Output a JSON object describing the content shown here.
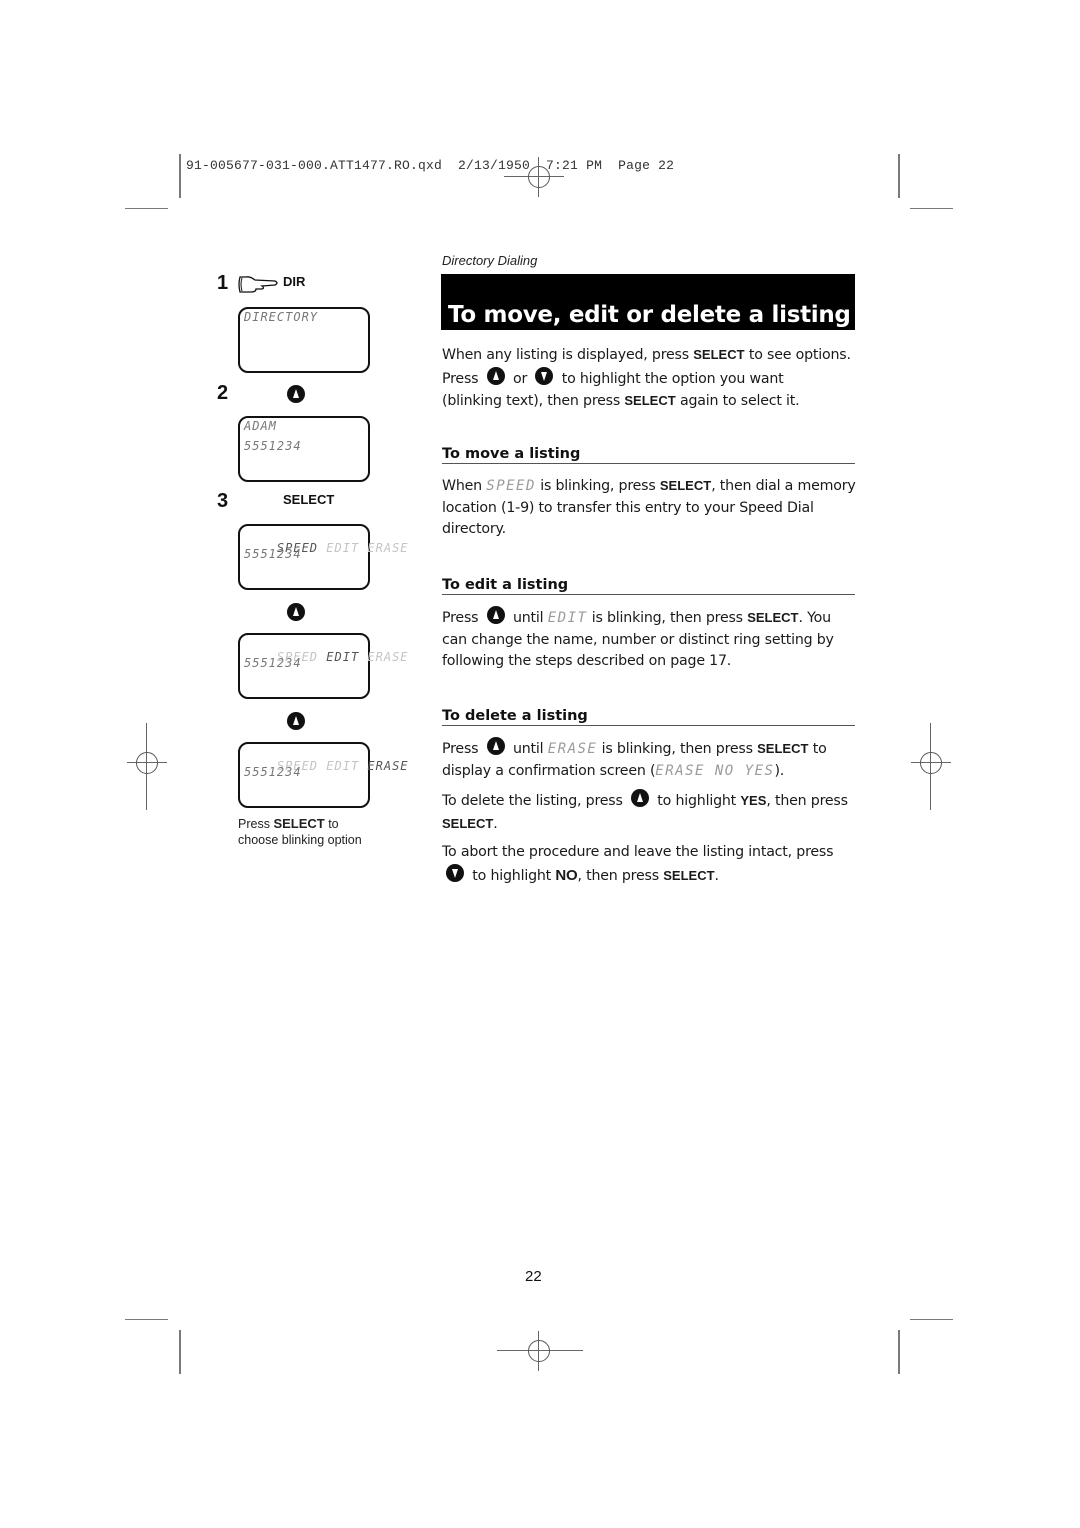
{
  "slug_line": "91-005677-031-000.ATT1477.RO.qxd  2/13/1950  7:21 PM  Page 22",
  "left_column": {
    "steps": [
      {
        "number": "1",
        "key": "DIR",
        "key_icon": "pointing-hand-icon"
      },
      {
        "number": "2",
        "key_icon": "up-arrow-button-icon"
      },
      {
        "number": "3",
        "key": "SELECT"
      }
    ],
    "screens": [
      {
        "line1": "DIRECTORY",
        "line2": ""
      },
      {
        "line1": "ADAM",
        "line2": "5551234"
      },
      {
        "options": [
          "SPEED",
          "EDIT",
          "ERASE"
        ],
        "active": "SPEED",
        "line2": "5551234"
      },
      {
        "options": [
          "SPEED",
          "EDIT",
          "ERASE"
        ],
        "active": "EDIT",
        "line2": "5551234"
      },
      {
        "options": [
          "SPEED",
          "EDIT",
          "ERASE"
        ],
        "active": "ERASE",
        "line2": "5551234"
      }
    ],
    "between_icons": [
      "up-arrow-button-icon",
      "up-arrow-button-icon"
    ],
    "caption": {
      "pre": "Press ",
      "key": "SELECT",
      "post": " to",
      "line2": "choose blinking option"
    }
  },
  "right_column": {
    "section_tag": "Directory Dialing",
    "title": "To move, edit or delete a listing",
    "intro": {
      "p1a": "When any listing is displayed, press ",
      "p1key": "SELECT",
      "p1b": " to see options.",
      "p2a": "Press ",
      "p2mid": " or ",
      "p2b": " to highlight the option you want",
      "p3a": "(blinking text), then press ",
      "p3key": "SELECT",
      "p3b": " again to select it."
    },
    "move": {
      "heading": "To move a listing",
      "a": "When ",
      "lcd": "SPEED",
      "b": " is blinking, press ",
      "key": "SELECT",
      "c": ", then dial a memory location (1-9) to transfer this entry to your Speed Dial directory."
    },
    "edit": {
      "heading": "To edit a listing",
      "a": "Press ",
      "b": " until ",
      "lcd": "EDIT",
      "c": " is blinking, then press ",
      "key": "SELECT",
      "d": ". You can change the name, number or distinct ring setting by following the steps described on page 17."
    },
    "delete": {
      "heading": "To delete a listing",
      "p1a": "Press ",
      "p1b": " until ",
      "p1lcd": "ERASE",
      "p1c": " is blinking, then press ",
      "p1key": "SELECT",
      "p1d": " to display a confirmation screen (",
      "p1lcd2": "ERASE NO YES",
      "p1e": ").",
      "p2a": "To delete the listing, press ",
      "p2b": " to highlight ",
      "p2key": "YES",
      "p2c": ", then press ",
      "p2key2": "SELECT",
      "p2d": ".",
      "p3a": "To abort the procedure and leave the listing intact, press ",
      "p3b": " to highlight ",
      "p3key": "NO",
      "p3c": ", then press ",
      "p3key2": "SELECT",
      "p3d": "."
    }
  },
  "page_number": "22"
}
